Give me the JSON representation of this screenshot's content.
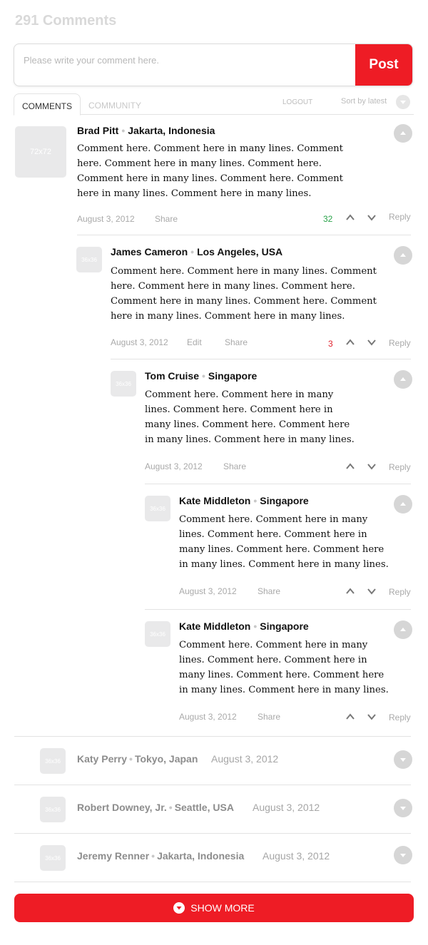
{
  "header": {
    "title": "291 Comments"
  },
  "composer": {
    "placeholder": "Please write your comment here.",
    "post_label": "Post"
  },
  "tabs": {
    "comments": "COMMENTS",
    "community": "COMMUNITY",
    "logout": "LOGOUT",
    "sort": "Sort by latest"
  },
  "colors": {
    "accent": "#ee1c25",
    "positive": "#2aa34a",
    "negative": "#e0232e"
  },
  "comments": [
    {
      "avatar": "72x72",
      "name": "Brad Pitt",
      "location": "Jakarta, Indonesia",
      "text": "Comment here. Comment here in many lines. Comment here. Comment here in many lines. Comment here. Comment here in many lines. Comment here. Comment here in many lines. Comment here in many lines.",
      "date": "August 3, 2012",
      "share": "Share",
      "score": "32",
      "reply": "Reply"
    },
    {
      "avatar": "36x36",
      "name": "James Cameron",
      "location": "Los Angeles, USA",
      "text": "Comment here. Comment here in many lines. Comment here. Comment here in many lines. Comment here. Comment here in many lines. Comment here. Comment here in many lines. Comment here in many lines.",
      "date": "August 3, 2012",
      "edit": "Edit",
      "share": "Share",
      "score": "3",
      "reply": "Reply"
    },
    {
      "avatar": "36x36",
      "name": "Tom Cruise",
      "location": "Singapore",
      "text": "Comment here. Comment here in many lines. Comment here. Comment here in many lines. Comment here. Comment here in many lines. Comment here in many lines.",
      "date": "August 3, 2012",
      "share": "Share",
      "reply": "Reply"
    },
    {
      "avatar": "36x36",
      "name": "Kate Middleton",
      "location": "Singapore",
      "text": "Comment here. Comment here in many lines. Comment here. Comment here in many lines. Comment here. Comment here in many lines. Comment here in many lines.",
      "date": "August 3, 2012",
      "share": "Share",
      "reply": "Reply"
    },
    {
      "avatar": "36x36",
      "name": "Kate Middleton",
      "location": "Singapore",
      "text": "Comment here. Comment here in many lines. Comment here. Comment here in many lines. Comment here. Comment here in many lines. Comment here in many lines.",
      "date": "August 3, 2012",
      "share": "Share",
      "reply": "Reply"
    }
  ],
  "collapsed": [
    {
      "avatar": "36x36",
      "name": "Katy Perry",
      "location": "Tokyo, Japan",
      "date": "August 3, 2012"
    },
    {
      "avatar": "36x36",
      "name": "Robert Downey, Jr.",
      "location": "Seattle, USA",
      "date": "August 3, 2012"
    },
    {
      "avatar": "36x36",
      "name": "Jeremy Renner",
      "location": "Jakarta, Indonesia",
      "date": "August 3, 2012"
    }
  ],
  "show_more": {
    "label": "SHOW MORE"
  }
}
